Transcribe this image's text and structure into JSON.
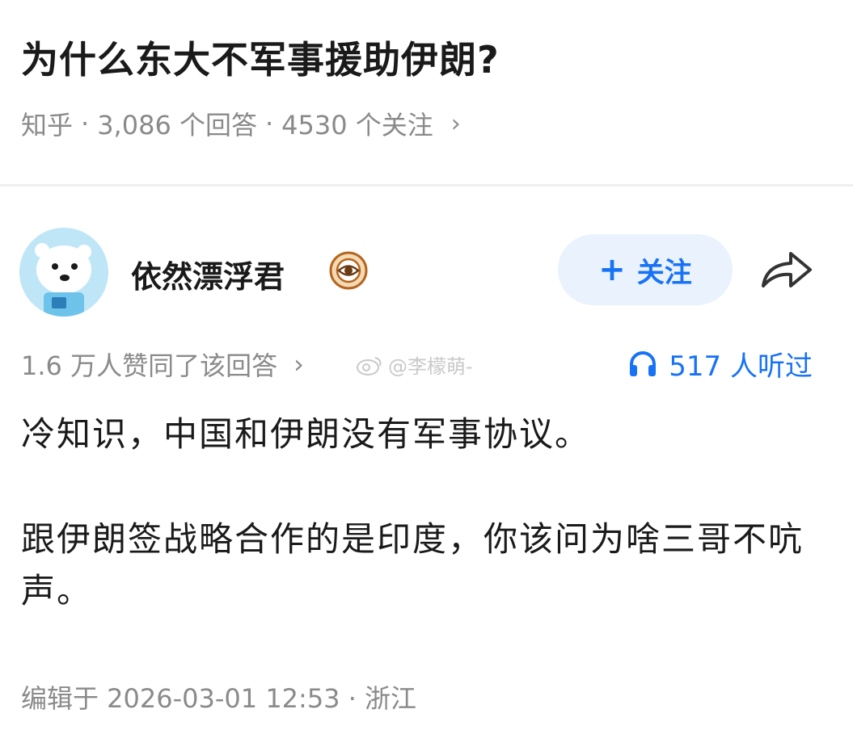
{
  "question": {
    "title": "为什么东大不军事援助伊朗?",
    "source": "知乎",
    "answers_count": "3,086 个回答",
    "followers_count": "4530 个关注",
    "chevron": "›"
  },
  "author": {
    "name": "依然漂浮君",
    "avatar_icon": "polar-bear-avatar",
    "badge_icon": "eye-badge-icon",
    "follow_label": "关注",
    "follow_plus": "+"
  },
  "answer": {
    "upvotes_text": "1.6 万人赞同了该回答",
    "upvotes_chevron": "›",
    "watermark": "@李檬萌-",
    "listen_text": "517 人听过",
    "paragraphs": [
      "冷知识，中国和伊朗没有军事协议。",
      "跟伊朗签战略合作的是印度，你该问为啥三哥不吭声。"
    ],
    "edit_info": "编辑于 2026-03-01 12:53 · 浙江"
  },
  "colors": {
    "accent": "#1772f6",
    "follow_bg": "#eaf2fd",
    "meta_text": "#8a8a8a"
  }
}
